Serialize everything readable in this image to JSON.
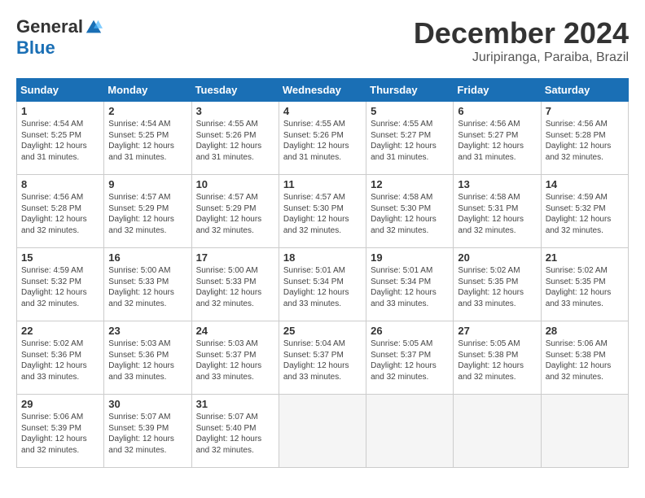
{
  "header": {
    "logo_general": "General",
    "logo_blue": "Blue",
    "month_title": "December 2024",
    "subtitle": "Juripiranga, Paraiba, Brazil"
  },
  "weekdays": [
    "Sunday",
    "Monday",
    "Tuesday",
    "Wednesday",
    "Thursday",
    "Friday",
    "Saturday"
  ],
  "weeks": [
    [
      {
        "day": "1",
        "rise": "4:54 AM",
        "set": "5:25 PM",
        "daylight": "12 hours and 31 minutes."
      },
      {
        "day": "2",
        "rise": "4:54 AM",
        "set": "5:25 PM",
        "daylight": "12 hours and 31 minutes."
      },
      {
        "day": "3",
        "rise": "4:55 AM",
        "set": "5:26 PM",
        "daylight": "12 hours and 31 minutes."
      },
      {
        "day": "4",
        "rise": "4:55 AM",
        "set": "5:26 PM",
        "daylight": "12 hours and 31 minutes."
      },
      {
        "day": "5",
        "rise": "4:55 AM",
        "set": "5:27 PM",
        "daylight": "12 hours and 31 minutes."
      },
      {
        "day": "6",
        "rise": "4:56 AM",
        "set": "5:27 PM",
        "daylight": "12 hours and 31 minutes."
      },
      {
        "day": "7",
        "rise": "4:56 AM",
        "set": "5:28 PM",
        "daylight": "12 hours and 32 minutes."
      }
    ],
    [
      {
        "day": "8",
        "rise": "4:56 AM",
        "set": "5:28 PM",
        "daylight": "12 hours and 32 minutes."
      },
      {
        "day": "9",
        "rise": "4:57 AM",
        "set": "5:29 PM",
        "daylight": "12 hours and 32 minutes."
      },
      {
        "day": "10",
        "rise": "4:57 AM",
        "set": "5:29 PM",
        "daylight": "12 hours and 32 minutes."
      },
      {
        "day": "11",
        "rise": "4:57 AM",
        "set": "5:30 PM",
        "daylight": "12 hours and 32 minutes."
      },
      {
        "day": "12",
        "rise": "4:58 AM",
        "set": "5:30 PM",
        "daylight": "12 hours and 32 minutes."
      },
      {
        "day": "13",
        "rise": "4:58 AM",
        "set": "5:31 PM",
        "daylight": "12 hours and 32 minutes."
      },
      {
        "day": "14",
        "rise": "4:59 AM",
        "set": "5:32 PM",
        "daylight": "12 hours and 32 minutes."
      }
    ],
    [
      {
        "day": "15",
        "rise": "4:59 AM",
        "set": "5:32 PM",
        "daylight": "12 hours and 32 minutes."
      },
      {
        "day": "16",
        "rise": "5:00 AM",
        "set": "5:33 PM",
        "daylight": "12 hours and 32 minutes."
      },
      {
        "day": "17",
        "rise": "5:00 AM",
        "set": "5:33 PM",
        "daylight": "12 hours and 32 minutes."
      },
      {
        "day": "18",
        "rise": "5:01 AM",
        "set": "5:34 PM",
        "daylight": "12 hours and 33 minutes."
      },
      {
        "day": "19",
        "rise": "5:01 AM",
        "set": "5:34 PM",
        "daylight": "12 hours and 33 minutes."
      },
      {
        "day": "20",
        "rise": "5:02 AM",
        "set": "5:35 PM",
        "daylight": "12 hours and 33 minutes."
      },
      {
        "day": "21",
        "rise": "5:02 AM",
        "set": "5:35 PM",
        "daylight": "12 hours and 33 minutes."
      }
    ],
    [
      {
        "day": "22",
        "rise": "5:02 AM",
        "set": "5:36 PM",
        "daylight": "12 hours and 33 minutes."
      },
      {
        "day": "23",
        "rise": "5:03 AM",
        "set": "5:36 PM",
        "daylight": "12 hours and 33 minutes."
      },
      {
        "day": "24",
        "rise": "5:03 AM",
        "set": "5:37 PM",
        "daylight": "12 hours and 33 minutes."
      },
      {
        "day": "25",
        "rise": "5:04 AM",
        "set": "5:37 PM",
        "daylight": "12 hours and 33 minutes."
      },
      {
        "day": "26",
        "rise": "5:05 AM",
        "set": "5:37 PM",
        "daylight": "12 hours and 32 minutes."
      },
      {
        "day": "27",
        "rise": "5:05 AM",
        "set": "5:38 PM",
        "daylight": "12 hours and 32 minutes."
      },
      {
        "day": "28",
        "rise": "5:06 AM",
        "set": "5:38 PM",
        "daylight": "12 hours and 32 minutes."
      }
    ],
    [
      {
        "day": "29",
        "rise": "5:06 AM",
        "set": "5:39 PM",
        "daylight": "12 hours and 32 minutes."
      },
      {
        "day": "30",
        "rise": "5:07 AM",
        "set": "5:39 PM",
        "daylight": "12 hours and 32 minutes."
      },
      {
        "day": "31",
        "rise": "5:07 AM",
        "set": "5:40 PM",
        "daylight": "12 hours and 32 minutes."
      },
      null,
      null,
      null,
      null
    ]
  ]
}
